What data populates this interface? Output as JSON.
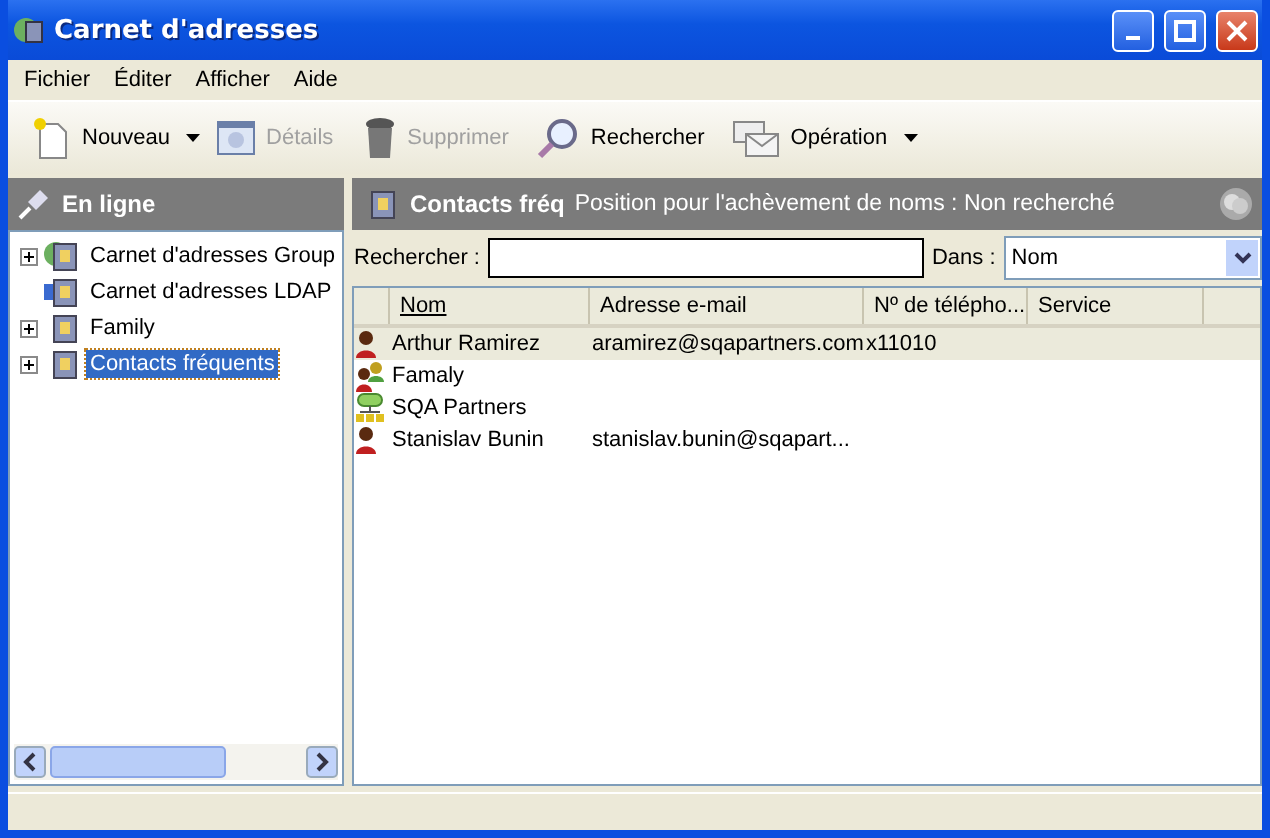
{
  "window": {
    "title": "Carnet d'adresses"
  },
  "menu": [
    "Fichier",
    "Éditer",
    "Afficher",
    "Aide"
  ],
  "toolbar": [
    {
      "label": "Nouveau",
      "kind": "new",
      "disabled": false,
      "dropdown": true
    },
    {
      "label": "Détails",
      "kind": "details",
      "disabled": true,
      "dropdown": false
    },
    {
      "label": "Supprimer",
      "kind": "delete",
      "disabled": true,
      "dropdown": false
    },
    {
      "label": "Rechercher",
      "kind": "search",
      "disabled": false,
      "dropdown": false
    },
    {
      "label": "Opération",
      "kind": "operation",
      "disabled": false,
      "dropdown": true
    }
  ],
  "sidebar": {
    "title": "En ligne",
    "items": [
      {
        "label": "Carnet d'adresses Group",
        "kind": "group",
        "expandable": true,
        "selected": false
      },
      {
        "label": "Carnet d'adresses LDAP",
        "kind": "ldap",
        "expandable": false,
        "selected": false
      },
      {
        "label": "Family",
        "kind": "book",
        "expandable": true,
        "selected": false
      },
      {
        "label": "Contacts fréquents",
        "kind": "book",
        "expandable": true,
        "selected": true
      }
    ]
  },
  "content": {
    "title": "Contacts fréq",
    "status": "Position pour l'achèvement de noms :  Non recherché",
    "search": {
      "label": "Rechercher :",
      "scope_label": "Dans :",
      "scope": "Nom"
    },
    "table": {
      "columns": [
        {
          "label": "Nom",
          "sorted": true
        },
        {
          "label": "Adresse e-mail",
          "sorted": false
        },
        {
          "label": "Nº de télépho...",
          "sorted": false
        },
        {
          "label": "Service",
          "sorted": false
        }
      ],
      "rows": [
        {
          "kind": "person",
          "selected": true,
          "cells": [
            "Arthur Ramirez",
            "aramirez@sqapartners.com",
            "x11010",
            ""
          ]
        },
        {
          "kind": "list",
          "selected": false,
          "cells": [
            "Famaly",
            "",
            "",
            ""
          ]
        },
        {
          "kind": "company",
          "selected": false,
          "cells": [
            "SQA Partners",
            "",
            "",
            ""
          ]
        },
        {
          "kind": "person",
          "selected": false,
          "cells": [
            "Stanislav Bunin",
            "stanislav.bunin@sqapart...",
            "",
            ""
          ]
        }
      ]
    }
  }
}
